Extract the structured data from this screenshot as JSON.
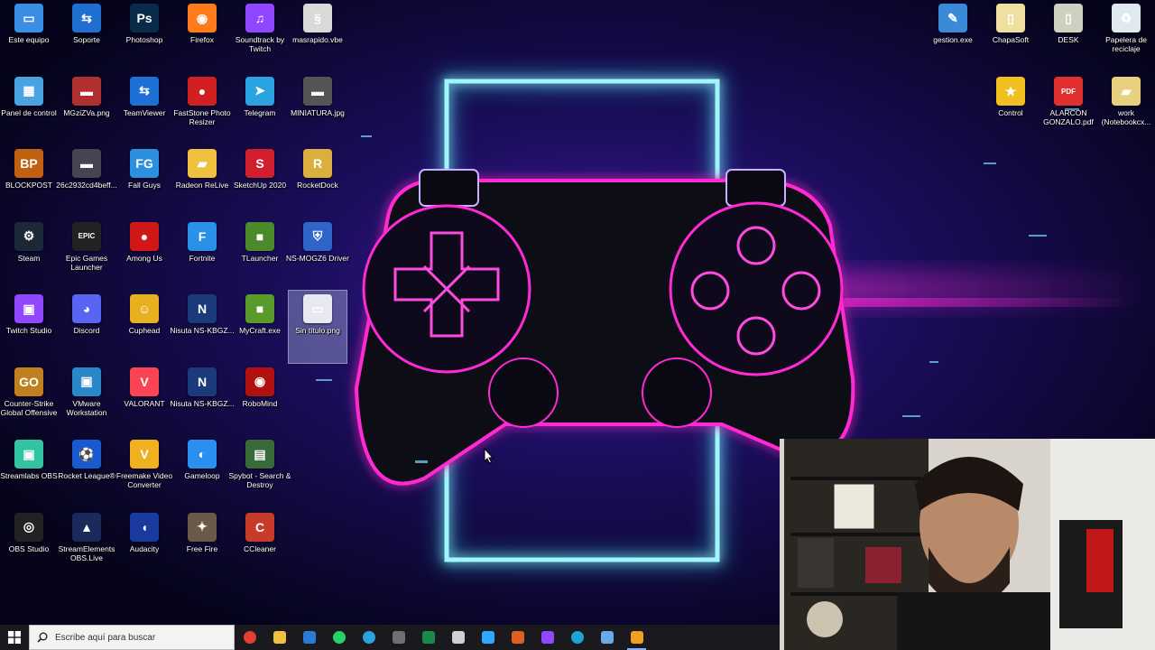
{
  "desktop": {
    "icons": [
      {
        "name": "este-equipo-icon",
        "label": "Este equipo",
        "color": "#3a8ee6",
        "glyph": "▭"
      },
      {
        "name": "soporte-icon",
        "label": "Soporte",
        "color": "#1f6fd1",
        "glyph": "⇆"
      },
      {
        "name": "photoshop-icon",
        "label": "Photoshop",
        "color": "#0a2a4a",
        "glyph": "Ps"
      },
      {
        "name": "firefox-icon",
        "label": "Firefox",
        "color": "#ff7a1a",
        "glyph": "◉"
      },
      {
        "name": "twitch-soundtrack-icon",
        "label": "Soundtrack by Twitch",
        "color": "#9146ff",
        "glyph": "♫"
      },
      {
        "name": "vbe-script-icon",
        "label": "masrapido.vbe",
        "color": "#d9d9d9",
        "glyph": "§"
      },
      {
        "name": "panel-de-control-icon",
        "label": "Panel de control",
        "color": "#4aa3e0",
        "glyph": "▦"
      },
      {
        "name": "image-file-icon",
        "label": "MGziZVa.png",
        "color": "#b03030",
        "glyph": "▬"
      },
      {
        "name": "teamviewer-icon",
        "label": "TeamViewer",
        "color": "#1e6fd6",
        "glyph": "⇆"
      },
      {
        "name": "faststone-icon",
        "label": "FastStone Photo Resizer",
        "color": "#d02020",
        "glyph": "●"
      },
      {
        "name": "telegram-icon",
        "label": "Telegram",
        "color": "#2aa3e0",
        "glyph": "➤"
      },
      {
        "name": "image-file-icon",
        "label": "MINIATURA.jpg",
        "color": "#555",
        "glyph": "▬"
      },
      {
        "name": "blockpost-icon",
        "label": "BLOCKPOST",
        "color": "#c06010",
        "glyph": "BP"
      },
      {
        "name": "image-file-icon",
        "label": "26c2932cd4beff...",
        "color": "#445",
        "glyph": "▬"
      },
      {
        "name": "fall-guys-icon",
        "label": "Fall Guys",
        "color": "#2c8fe0",
        "glyph": "FG"
      },
      {
        "name": "folder-icon",
        "label": "Radeon ReLive",
        "color": "#f0c040",
        "glyph": "▰"
      },
      {
        "name": "sketchup-icon",
        "label": "SketchUp 2020",
        "color": "#d02030",
        "glyph": "S"
      },
      {
        "name": "rocketdock-icon",
        "label": "RocketDock",
        "color": "#d9b040",
        "glyph": "R"
      },
      {
        "name": "steam-icon",
        "label": "Steam",
        "color": "#1b2838",
        "glyph": "⚙"
      },
      {
        "name": "epic-games-icon",
        "label": "Epic Games Launcher",
        "color": "#222",
        "glyph": "EPIC"
      },
      {
        "name": "among-us-icon",
        "label": "Among Us",
        "color": "#d01818",
        "glyph": "●"
      },
      {
        "name": "fortnite-icon",
        "label": "Fortnite",
        "color": "#2a90e8",
        "glyph": "F"
      },
      {
        "name": "tlauncher-icon",
        "label": "TLauncher",
        "color": "#4a8a2a",
        "glyph": "■"
      },
      {
        "name": "driver-shield-icon",
        "label": "NS-MOGZ6 Driver",
        "color": "#2f64c8",
        "glyph": "⛨"
      },
      {
        "name": "twitch-studio-icon",
        "label": "Twitch Studio",
        "color": "#9146ff",
        "glyph": "▣"
      },
      {
        "name": "discord-icon",
        "label": "Discord",
        "color": "#5865f2",
        "glyph": "◕"
      },
      {
        "name": "cuphead-icon",
        "label": "Cuphead",
        "color": "#e8b020",
        "glyph": "☺"
      },
      {
        "name": "nisuta-icon",
        "label": "Nisuta NS-KBGZ...",
        "color": "#1a3a7a",
        "glyph": "N"
      },
      {
        "name": "mycraft-icon",
        "label": "MyCraft.exe",
        "color": "#5a9a2a",
        "glyph": "■"
      },
      {
        "name": "image-file-icon",
        "label": "Sin título.png",
        "color": "#e8e8f0",
        "glyph": "▭",
        "selected": true
      },
      {
        "name": "counter-strike-icon",
        "label": "Counter-Strike Global Offensive",
        "color": "#c08020",
        "glyph": "GO"
      },
      {
        "name": "vmware-icon",
        "label": "VMware Workstation",
        "color": "#2a88c8",
        "glyph": "▣"
      },
      {
        "name": "valorant-icon",
        "label": "VALORANT",
        "color": "#fa4454",
        "glyph": "V"
      },
      {
        "name": "nisuta-icon",
        "label": "Nisuta NS-KBGZ...",
        "color": "#1a3a7a",
        "glyph": "N"
      },
      {
        "name": "robomind-icon",
        "label": "RoboMind",
        "color": "#b01010",
        "glyph": "◉"
      },
      {
        "name": "empty-slot",
        "label": "",
        "color": "transparent",
        "glyph": ""
      },
      {
        "name": "streamlabs-icon",
        "label": "Streamlabs OBS",
        "color": "#31c3a2",
        "glyph": "▣"
      },
      {
        "name": "rocket-league-icon",
        "label": "Rocket League®",
        "color": "#1a5ad0",
        "glyph": "⚽"
      },
      {
        "name": "freemake-icon",
        "label": "Freemake Video Converter",
        "color": "#f0b020",
        "glyph": "V"
      },
      {
        "name": "gameloop-icon",
        "label": "Gameloop",
        "color": "#2a90f0",
        "glyph": "◐"
      },
      {
        "name": "spybot-icon",
        "label": "Spybot - Search & Destroy",
        "color": "#3a6a3a",
        "glyph": "▤"
      },
      {
        "name": "empty-slot",
        "label": "",
        "color": "transparent",
        "glyph": ""
      },
      {
        "name": "obs-studio-icon",
        "label": "OBS Studio",
        "color": "#222",
        "glyph": "◎"
      },
      {
        "name": "streamelements-icon",
        "label": "StreamElements OBS.Live",
        "color": "#1a2a5a",
        "glyph": "▲"
      },
      {
        "name": "audacity-icon",
        "label": "Audacity",
        "color": "#1a3aa0",
        "glyph": "◖"
      },
      {
        "name": "free-fire-icon",
        "label": "Free Fire",
        "color": "#6a5a4a",
        "glyph": "✦"
      },
      {
        "name": "ccleaner-icon",
        "label": "CCleaner",
        "color": "#c83a2a",
        "glyph": "C"
      }
    ],
    "right_icons": [
      {
        "name": "gestion-exe-icon",
        "label": "gestion.exe",
        "color": "#3a8ad8",
        "glyph": "✎"
      },
      {
        "name": "chapasoft-icon",
        "label": "ChapaSoft",
        "color": "#f0e0a0",
        "glyph": "▯"
      },
      {
        "name": "desk-icon",
        "label": "DESK",
        "color": "#d0d0c0",
        "glyph": "▯"
      },
      {
        "name": "recycle-bin-icon",
        "label": "Papelera de reciclaje",
        "color": "#e0e8f0",
        "glyph": "♻"
      },
      {
        "name": "control-icon",
        "label": "Control",
        "color": "#f0c020",
        "glyph": "★"
      },
      {
        "name": "pdf-icon",
        "label": "ALARCON GONZALO.pdf",
        "color": "#e03030",
        "glyph": "PDF"
      },
      {
        "name": "work-folder-icon",
        "label": "work (Notebookcx...",
        "color": "#e8d080",
        "glyph": "▰"
      }
    ]
  },
  "taskbar": {
    "search_placeholder": "Escribe aquí para buscar",
    "apps": [
      {
        "name": "chrome-taskbar-icon",
        "color": "#e04030"
      },
      {
        "name": "file-explorer-taskbar-icon",
        "color": "#f0c040"
      },
      {
        "name": "mail-taskbar-icon",
        "color": "#2a7ad8"
      },
      {
        "name": "whatsapp-taskbar-icon",
        "color": "#25d366"
      },
      {
        "name": "telegram-taskbar-icon",
        "color": "#2aa3e0"
      },
      {
        "name": "calculator-taskbar-icon",
        "color": "#707070"
      },
      {
        "name": "terminal-taskbar-icon",
        "color": "#1a8a4a"
      },
      {
        "name": "music-taskbar-icon",
        "color": "#d0d0d0"
      },
      {
        "name": "photoshop-taskbar-icon",
        "color": "#31a8ff"
      },
      {
        "name": "app-taskbar-icon",
        "color": "#e06020"
      },
      {
        "name": "twitch-taskbar-icon",
        "color": "#9146ff"
      },
      {
        "name": "edge-taskbar-icon",
        "color": "#1fa2d8"
      },
      {
        "name": "notepad-taskbar-icon",
        "color": "#6aa8e8"
      },
      {
        "name": "streamelements-taskbar-icon",
        "color": "#f0a020"
      }
    ]
  },
  "colors": {
    "neon_pink": "#ff2ad4",
    "neon_cyan": "#2fe8ff",
    "neon_purple": "#8a2be2"
  }
}
